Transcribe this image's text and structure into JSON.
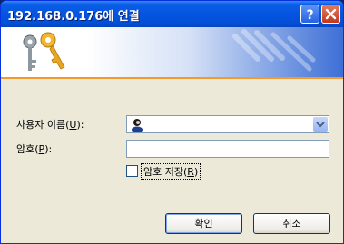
{
  "window": {
    "title": "192.168.0.176에 연결"
  },
  "titlebar": {
    "help_icon": "help-icon",
    "close_icon": "close-icon"
  },
  "form": {
    "username_label_prefix": "사용자 이름(",
    "username_accesskey": "U",
    "username_label_suffix": "):",
    "username_value": "",
    "user_icon": "user-icon",
    "password_label_prefix": "암호(",
    "password_accesskey": "P",
    "password_label_suffix": "):",
    "password_value": "",
    "save_password_prefix": "암호 저장(",
    "save_password_accesskey": "R",
    "save_password_suffix": ")",
    "save_password_checked": false
  },
  "buttons": {
    "ok": "확인",
    "cancel": "취소"
  }
}
